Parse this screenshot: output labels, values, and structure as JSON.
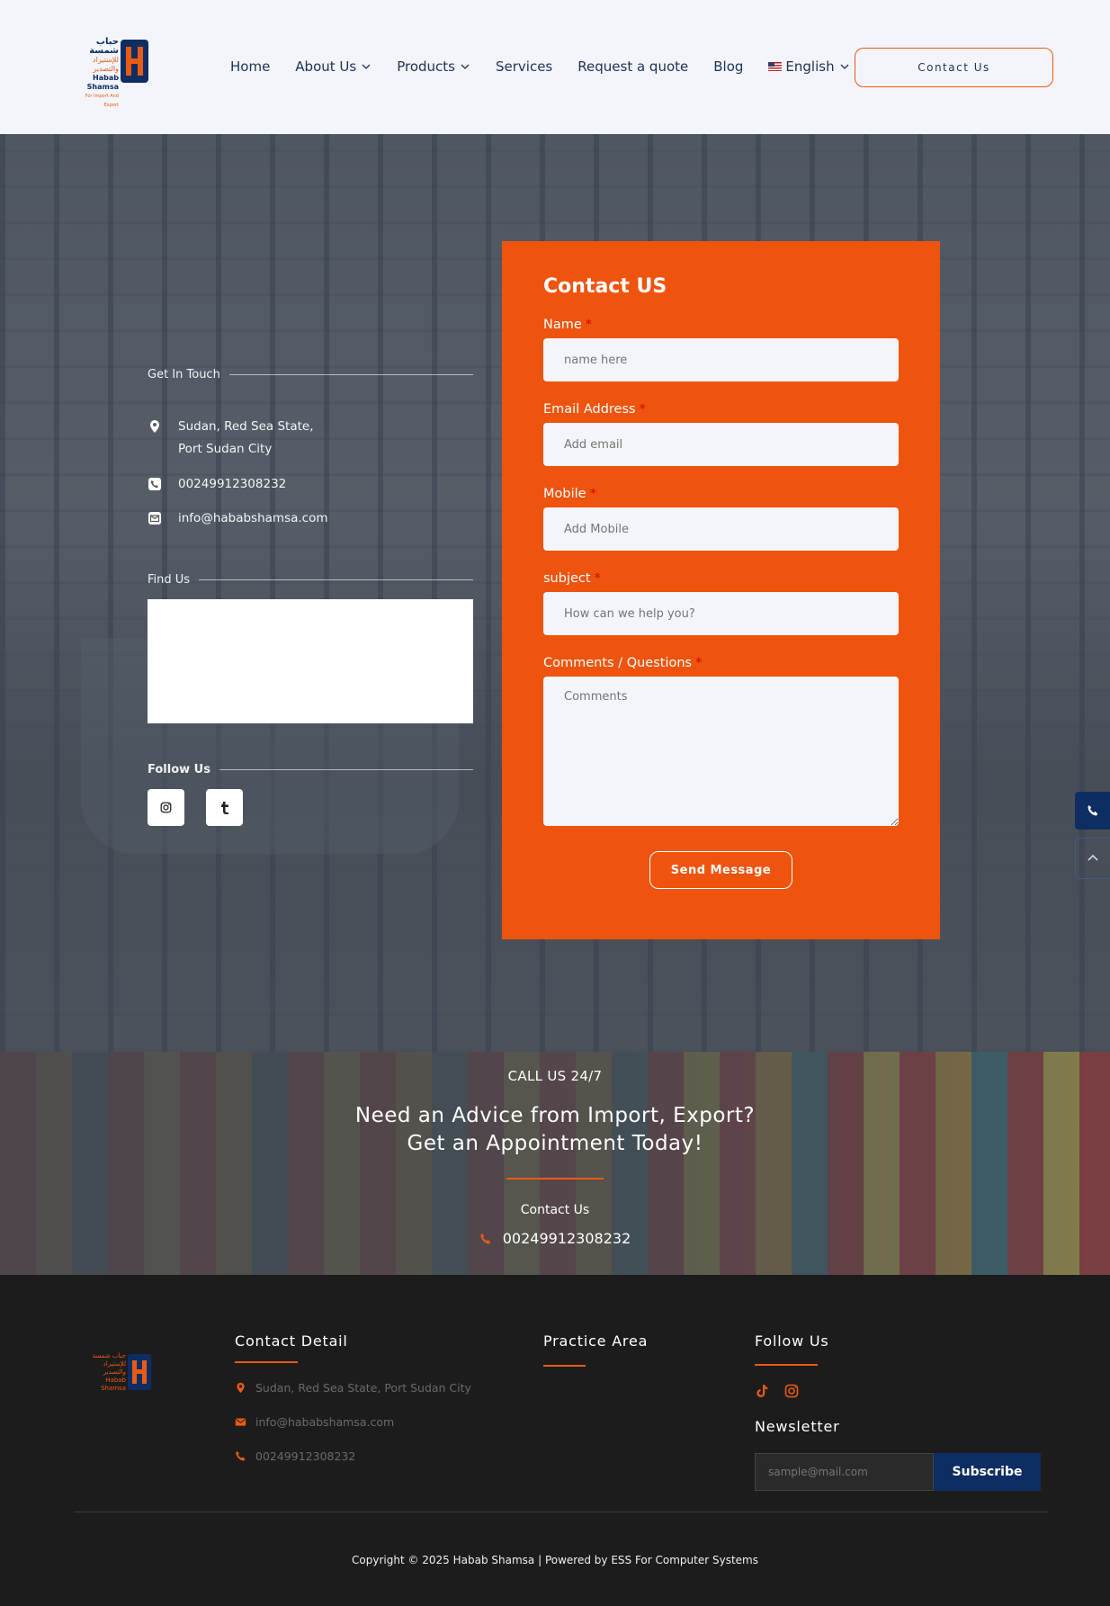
{
  "header": {
    "logo": {
      "arabic_line1": "حباب شمسة",
      "arabic_line2": "للإستيراد والتصدير",
      "english_line1": "Habab Shamsa",
      "english_line2": "For Import And Export"
    },
    "nav": [
      "Home",
      "About Us",
      "Products",
      "Services",
      "Request a quote",
      "Blog",
      "English"
    ],
    "contact_button": "Contact Us"
  },
  "contact_info": {
    "get_in_touch": "Get In Touch",
    "address_line1": "Sudan, Red Sea State,",
    "address_line2": "Port Sudan City",
    "phone": "00249912308232",
    "email": "info@hababshamsa.com",
    "find_us": "Find Us",
    "follow_us": "Follow Us"
  },
  "form": {
    "title": "Contact US",
    "required_mark": "*",
    "name_label": "Name",
    "name_placeholder": "name here",
    "email_label": "Email Address",
    "email_placeholder": "Add email",
    "mobile_label": "Mobile",
    "mobile_placeholder": "Add Mobile",
    "subject_label": "subject",
    "subject_placeholder": "How can we help you?",
    "comments_label": "Comments / Questions",
    "comments_placeholder": "Comments",
    "submit": "Send Message"
  },
  "appointment": {
    "kicker": "CALL US 24/7",
    "headline_line1": "Need an Advice from Import, Export?",
    "headline_line2": "Get an Appointment Today!",
    "contact_label": "Contact Us",
    "phone": "00249912308232"
  },
  "footer": {
    "contact_detail_title": "Contact Detail",
    "address": "Sudan, Red Sea State, Port Sudan City",
    "email": "info@hababshamsa.com",
    "phone": "00249912308232",
    "practice_area_title": "Practice Area",
    "follow_us_title": "Follow Us",
    "newsletter_title": "Newsletter",
    "newsletter_placeholder": "sample@mail.com",
    "subscribe": "Subscribe",
    "copyright": "Copyright © 2025 Habab Shamsa | Powered by ESS For Computer Systems"
  },
  "colors": {
    "accent": "#ee540e",
    "navy": "#0e2d63",
    "header_bg": "#f3f5fa",
    "footer_bg": "#1c1c1c"
  },
  "icons": [
    "map-pin-icon",
    "phone-icon",
    "envelope-icon",
    "instagram-icon",
    "tumblr-icon",
    "tiktok-icon",
    "chevron-down-icon",
    "chevron-up-icon"
  ]
}
